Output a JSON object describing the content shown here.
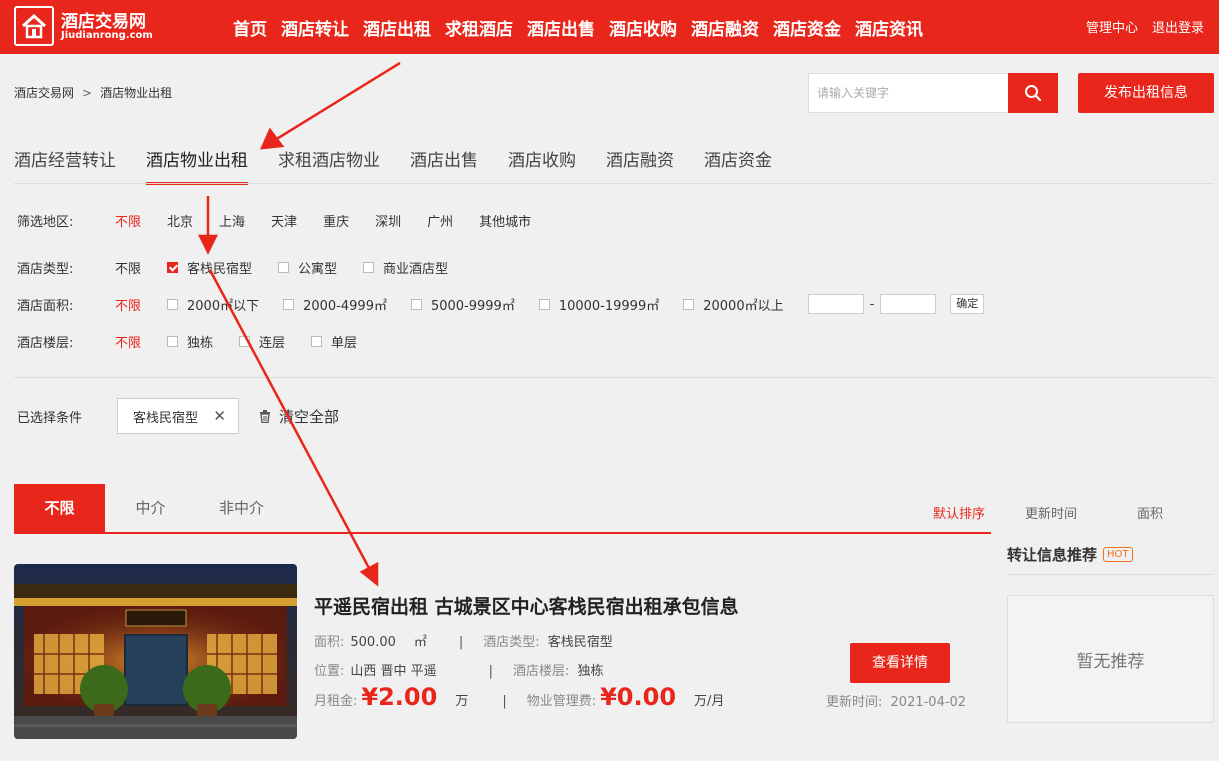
{
  "header": {
    "logo_cn": "酒店交易网",
    "logo_en": "Jiudianrong.com",
    "nav": [
      "首页",
      "酒店转让",
      "酒店出租",
      "求租酒店",
      "酒店出售",
      "酒店收购",
      "酒店融资",
      "酒店资金",
      "酒店资讯"
    ],
    "links": [
      "管理中心",
      "退出登录"
    ],
    "accent_color": "#e8261b"
  },
  "breadcrumb": {
    "home": "酒店交易网",
    "separator": ">",
    "current": "酒店物业出租"
  },
  "search": {
    "placeholder": "请输入关键字",
    "icon": "search-icon"
  },
  "publish_button": "发布出租信息",
  "category_tabs": [
    "酒店经营转让",
    "酒店物业出租",
    "求租酒店物业",
    "酒店出售",
    "酒店收购",
    "酒店融资",
    "酒店资金"
  ],
  "category_active": "酒店物业出租",
  "filters": {
    "region": {
      "label": "筛选地区:",
      "options": [
        "不限",
        "北京",
        "上海",
        "天津",
        "重庆",
        "深圳",
        "广州",
        "其他城市"
      ],
      "selected": "不限"
    },
    "type": {
      "label": "酒店类型:",
      "any": "不限",
      "options": [
        "客栈民宿型",
        "公寓型",
        "商业酒店型"
      ],
      "checked": "客栈民宿型"
    },
    "area": {
      "label": "酒店面积:",
      "any": "不限",
      "options": [
        "2000㎡以下",
        "2000-4999㎡",
        "5000-9999㎡",
        "10000-19999㎡",
        "20000㎡以上"
      ],
      "range_dash": "-",
      "confirm": "确定"
    },
    "floors": {
      "label": "酒店楼层:",
      "any": "不限",
      "options": [
        "独栋",
        "连层",
        "单层"
      ]
    }
  },
  "selected": {
    "label": "已选择条件",
    "chip": "客栈民宿型",
    "chip_close": "✕",
    "clear_all": "清空全部"
  },
  "agent_tabs": [
    "不限",
    "中介",
    "非中介"
  ],
  "agent_active": "不限",
  "sorts": [
    "默认排序",
    "更新时间",
    "面积"
  ],
  "sort_active": "默认排序",
  "listing": {
    "title": "平遥民宿出租 古城景区中心客栈民宿出租承包信息",
    "area_label": "面积:",
    "area_value": "500.00",
    "area_unit": "㎡",
    "type_label": "酒店类型:",
    "type_value": "客栈民宿型",
    "location_label": "位置:",
    "location_value": "山西 晋中 平遥",
    "floor_label": "酒店楼层:",
    "floor_value": "独栋",
    "rent_label": "月租金:",
    "rent_value": "¥2.00",
    "rent_unit": "万",
    "fee_label": "物业管理费:",
    "fee_value": "¥0.00",
    "fee_unit": "万/月",
    "pipe": "|",
    "detail_button": "查看详情",
    "update_label": "更新时间:",
    "update_value": "2021-04-02"
  },
  "sidebar": {
    "title": "转让信息推荐",
    "badge": "HOT",
    "empty": "暂无推荐"
  }
}
